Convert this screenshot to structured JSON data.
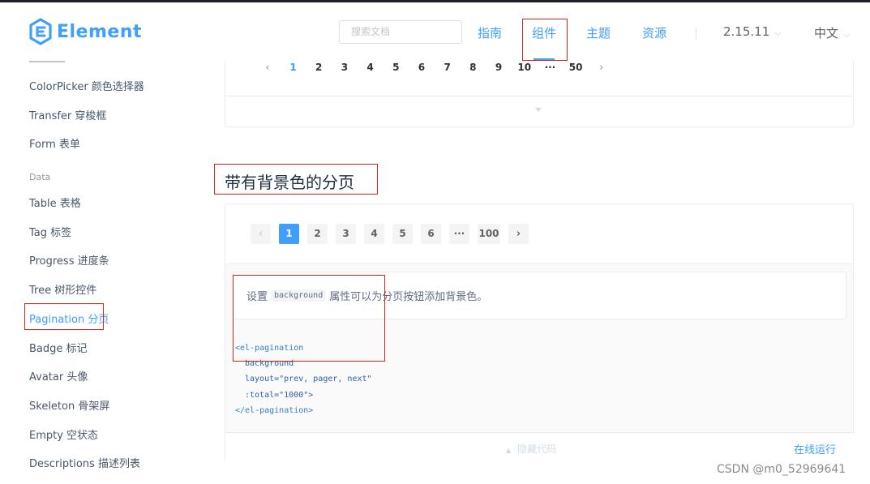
{
  "header": {
    "logo_text": "Element",
    "search_placeholder": "搜索文档",
    "nav": [
      "指南",
      "组件",
      "主题",
      "资源"
    ],
    "active_nav": "组件",
    "version": "2.15.11",
    "language": "中文"
  },
  "sidebar": {
    "items_before": [
      "ColorPicker 颜色选择器",
      "Transfer 穿梭框",
      "Form 表单"
    ],
    "group": "Data",
    "items": [
      "Table 表格",
      "Tag 标签",
      "Progress 进度条",
      "Tree 树形控件",
      "Pagination 分页",
      "Badge 标记",
      "Avatar 头像",
      "Skeleton 骨架屏",
      "Empty 空状态",
      "Descriptions 描述列表"
    ],
    "active": "Pagination 分页"
  },
  "demo_top": {
    "prev": "‹",
    "pages": [
      "1",
      "2",
      "3",
      "4",
      "5",
      "6",
      "7",
      "8",
      "9",
      "10",
      "···",
      "50"
    ],
    "current": "1",
    "next": "›"
  },
  "section": {
    "title": "带有背景色的分页"
  },
  "demo_bg": {
    "prev": "‹",
    "pages": [
      "1",
      "2",
      "3",
      "4",
      "5",
      "6",
      "···",
      "100"
    ],
    "current": "1",
    "next": "›",
    "desc_before": "设置",
    "desc_code": "background",
    "desc_after": "属性可以为分页按钮添加背景色。",
    "code_lines": [
      "<el-pagination",
      "background",
      "layout=\"prev, pager, next\"",
      ":total=\"1000\">",
      "</el-pagination>"
    ],
    "hide_code": "隐藏代码",
    "run_online": "在线运行"
  },
  "watermark": "CSDN @m0_52969641",
  "colors": {
    "accent": "#409eff",
    "annotation_red": "#d9261c"
  }
}
